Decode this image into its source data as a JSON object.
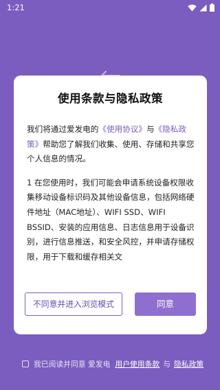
{
  "status_bar": {
    "time": "1:21"
  },
  "dialog": {
    "title": "使用条款与隐私政策",
    "p1_pre": "我们将通过爱发电的",
    "p1_link1": "《使用协议》",
    "p1_mid": "与",
    "p1_link2": "《隐私政策》",
    "p1_post": "帮助您了解我们收集、使用、存储和共享您个人信息的情况。",
    "p2": "1 在您使用时，我们可能会申请系统设备权限收集移动设备标识码及其他设备信息，包括网络硬件地址（MAC地址）、WIFI SSD、WIFI BSSID、安装的应用信息、日志信息用于设备识别，进行信息推送，和安全风控，并申请存储权限，用于下载和缓存相关文",
    "decline_label": "不同意并进入浏览模式",
    "agree_label": "同意"
  },
  "consent": {
    "prefix": "我已阅读并同意 爱发电",
    "terms_link": "用户使用条款",
    "and": "与",
    "privacy_link": "隐私政策"
  },
  "colors": {
    "background": "#7b5cbf",
    "accent": "#8e6fd0"
  },
  "icons": [
    "wifi-icon",
    "signal-icon",
    "battery-icon",
    "back-arrow-icon",
    "checkbox-icon"
  ]
}
